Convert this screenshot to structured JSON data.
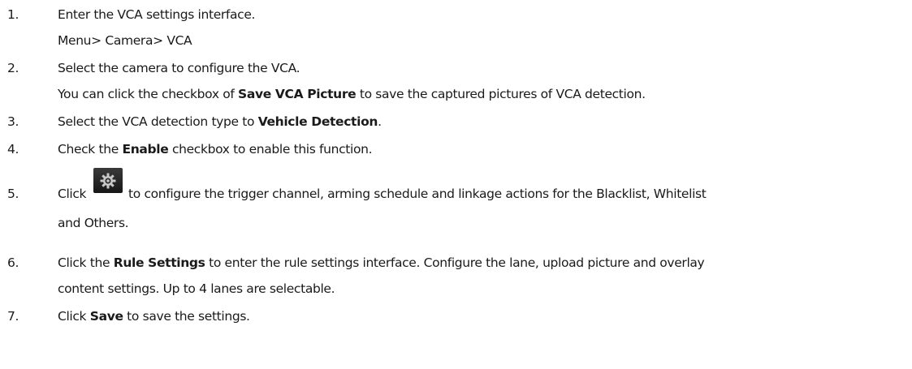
{
  "steps": [
    {
      "number": "1.",
      "line1": "Enter the VCA settings interface.",
      "line2": "Menu> Camera> VCA"
    },
    {
      "number": "2.",
      "line1": "Select the camera to configure the VCA.",
      "line2_pre": "You can click the checkbox of ",
      "line2_bold": "Save VCA Picture",
      "line2_post": " to save the captured pictures of VCA detection."
    },
    {
      "number": "3.",
      "pre": "Select the VCA detection type to ",
      "bold": "Vehicle Detection",
      "post": "."
    },
    {
      "number": "4.",
      "pre": "Check the ",
      "bold": "Enable",
      "post": " checkbox to enable this function."
    },
    {
      "number": "5.",
      "pre": "Click",
      "post": "to configure the trigger channel, arming schedule and linkage actions for the Blacklist, Whitelist",
      "line2": "and Others.",
      "icon": "gear-icon"
    },
    {
      "number": "6.",
      "pre": "Click the ",
      "bold": "Rule Settings",
      "post": " to enter the rule settings interface. Configure the lane, upload picture and overlay",
      "line2": "content settings. Up to 4 lanes are selectable."
    },
    {
      "number": "7.",
      "pre": "Click ",
      "bold": "Save",
      "post": " to save the settings."
    }
  ],
  "colors": {
    "text": "#1a1a1a",
    "icon_bg": "#222222",
    "icon_fg": "#c8c8c8"
  }
}
